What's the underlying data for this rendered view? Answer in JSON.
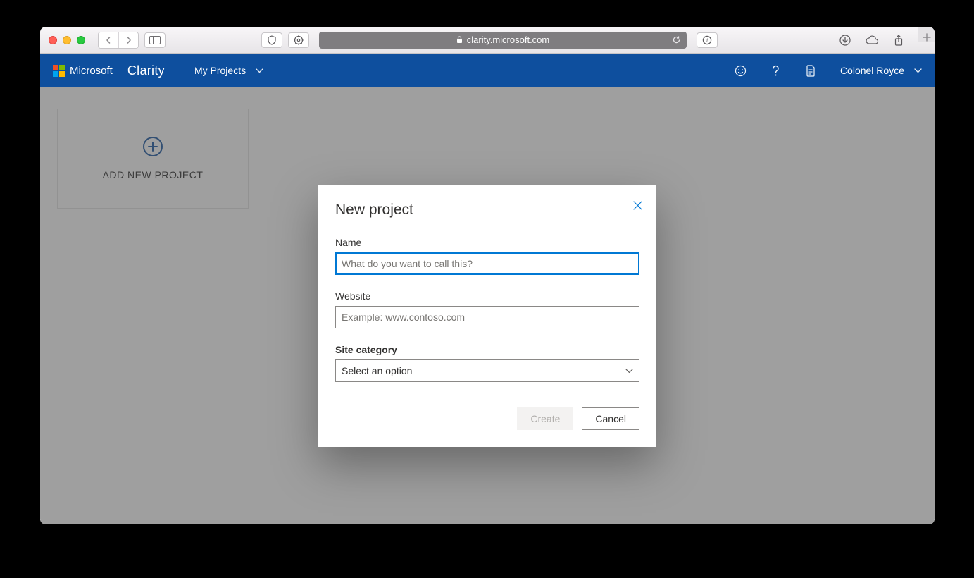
{
  "browser": {
    "url_display": "clarity.microsoft.com"
  },
  "clarity_header": {
    "company": "Microsoft",
    "product": "Clarity",
    "nav_label": "My Projects",
    "username": "Colonel Royce"
  },
  "add_card": {
    "label": "ADD NEW PROJECT"
  },
  "modal": {
    "title": "New project",
    "name_label": "Name",
    "name_placeholder": "What do you want to call this?",
    "website_label": "Website",
    "website_placeholder": "Example: www.contoso.com",
    "category_label": "Site category",
    "category_placeholder": "Select an option",
    "create_label": "Create",
    "cancel_label": "Cancel"
  }
}
